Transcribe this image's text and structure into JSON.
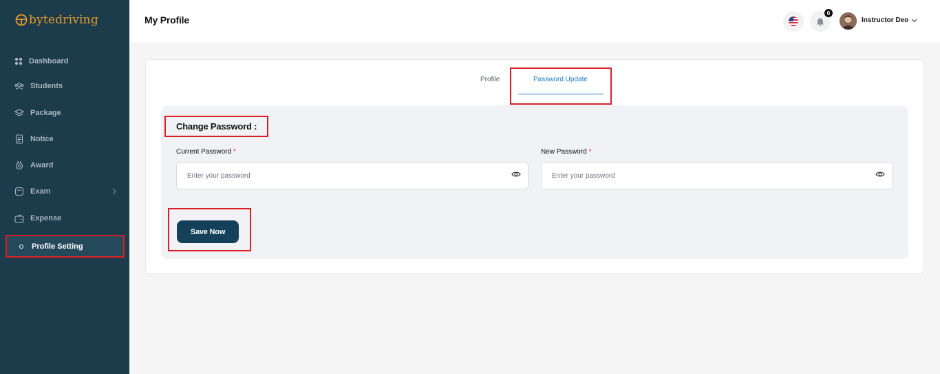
{
  "brand": {
    "prefix": "byte",
    "suffix": "driving",
    "color": "#e79b2c"
  },
  "sidebar": {
    "items": [
      {
        "label": "Dashboard",
        "icon": "grid-icon"
      },
      {
        "label": "Students",
        "icon": "users-icon"
      },
      {
        "label": "Package",
        "icon": "layers-icon"
      },
      {
        "label": "Notice",
        "icon": "document-icon"
      },
      {
        "label": "Award",
        "icon": "award-icon"
      },
      {
        "label": "Exam",
        "icon": "exam-icon",
        "has_submenu": true
      },
      {
        "label": "Expense",
        "icon": "wallet-icon"
      },
      {
        "label": "Profile Setting",
        "icon": "dot-icon",
        "active": true
      }
    ]
  },
  "header": {
    "title": "My Profile",
    "notification_count": "0",
    "user_name": "Instructor Deo"
  },
  "tabs": [
    {
      "label": "Profile",
      "active": false
    },
    {
      "label": "Password Update",
      "active": true
    }
  ],
  "form": {
    "heading": "Change Password :",
    "current_password": {
      "label": "Current Password",
      "required_mark": "*",
      "placeholder": "Enter your password",
      "value": ""
    },
    "new_password": {
      "label": "New Password",
      "required_mark": "*",
      "placeholder": "Enter your password",
      "value": ""
    },
    "submit_label": "Save Now"
  },
  "colors": {
    "sidebar_bg": "#1c3b4b",
    "accent": "#1b7ac2",
    "button": "#15405a",
    "highlight": "#d91f26"
  }
}
